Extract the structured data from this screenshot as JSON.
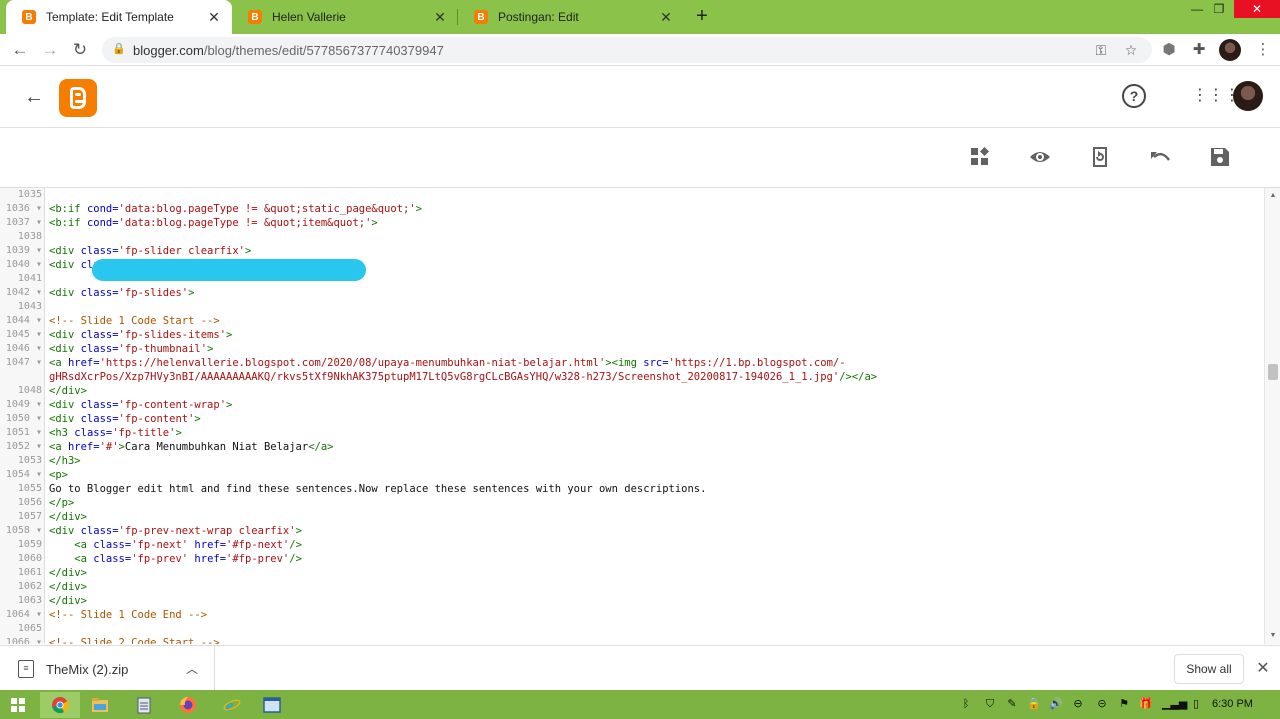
{
  "browser": {
    "tabs": [
      {
        "title": "Template: Edit Template",
        "favicon": "blogger-favicon-icon",
        "active": true
      },
      {
        "title": "Helen Vallerie",
        "favicon": "blogger-favicon-icon",
        "active": false
      },
      {
        "title": "Postingan: Edit",
        "favicon": "blogger-favicon-icon",
        "active": false
      }
    ],
    "url_domain": "blogger.com",
    "url_path": "/blog/themes/edit/5778567377740379947",
    "colors": {
      "frame": "#8bc34a",
      "accent": "#f57d00"
    }
  },
  "editor": {
    "lines": [
      {
        "n": "1035",
        "fold": false
      },
      {
        "n": "1036",
        "fold": true
      },
      {
        "n": "1037",
        "fold": true
      },
      {
        "n": "1038",
        "fold": false
      },
      {
        "n": "1039",
        "fold": true
      },
      {
        "n": "1040",
        "fold": true
      },
      {
        "n": "1041",
        "fold": false
      },
      {
        "n": "1042",
        "fold": true
      },
      {
        "n": "1043",
        "fold": false
      },
      {
        "n": "1044",
        "fold": true
      },
      {
        "n": "1045",
        "fold": true
      },
      {
        "n": "1046",
        "fold": true
      },
      {
        "n": "1047",
        "fold": true
      },
      {
        "n": "",
        "fold": false
      },
      {
        "n": "1048",
        "fold": false
      },
      {
        "n": "1049",
        "fold": true
      },
      {
        "n": "1050",
        "fold": true
      },
      {
        "n": "1051",
        "fold": true
      },
      {
        "n": "1052",
        "fold": true
      },
      {
        "n": "1053",
        "fold": false
      },
      {
        "n": "1054",
        "fold": true
      },
      {
        "n": "1055",
        "fold": false
      },
      {
        "n": "1056",
        "fold": false
      },
      {
        "n": "1057",
        "fold": false
      },
      {
        "n": "1058",
        "fold": true
      },
      {
        "n": "1059",
        "fold": false
      },
      {
        "n": "1060",
        "fold": false
      },
      {
        "n": "1061",
        "fold": false
      },
      {
        "n": "1062",
        "fold": false
      },
      {
        "n": "1063",
        "fold": false
      },
      {
        "n": "1064",
        "fold": true
      },
      {
        "n": "1065",
        "fold": false
      },
      {
        "n": "1066",
        "fold": true
      }
    ],
    "code": [
      [],
      [
        [
          "tag",
          "<b:if "
        ],
        [
          "attr",
          "cond="
        ],
        [
          "str",
          "'data:blog.pageType != &quot;static_page&quot;'"
        ],
        [
          "tag",
          ">"
        ]
      ],
      [
        [
          "tag",
          "<b:if "
        ],
        [
          "attr",
          "cond="
        ],
        [
          "str",
          "'data:blog.pageType != &quot;item&quot;'"
        ],
        [
          "tag",
          ">"
        ]
      ],
      [],
      [
        [
          "tag",
          "<div "
        ],
        [
          "attr",
          "class="
        ],
        [
          "str",
          "'fp-slider clearfix'"
        ],
        [
          "tag",
          ">"
        ]
      ],
      [
        [
          "tag",
          "<div "
        ],
        [
          "attr",
          "class="
        ],
        [
          "str",
          "'fp-slides-container clearfix'"
        ],
        [
          "tag",
          ">"
        ]
      ],
      [],
      [
        [
          "tag",
          "<div "
        ],
        [
          "attr",
          "class="
        ],
        [
          "str",
          "'fp-slides'"
        ],
        [
          "tag",
          ">"
        ]
      ],
      [],
      [
        [
          "cmt",
          "<!-- Slide 1 Code Start -->"
        ]
      ],
      [
        [
          "tag",
          "<div "
        ],
        [
          "attr",
          "class="
        ],
        [
          "str",
          "'fp-slides-items'"
        ],
        [
          "tag",
          ">"
        ]
      ],
      [
        [
          "tag",
          "<div "
        ],
        [
          "attr",
          "class="
        ],
        [
          "str",
          "'fp-thumbnail'"
        ],
        [
          "tag",
          ">"
        ]
      ],
      [
        [
          "tag",
          "<a "
        ],
        [
          "attr",
          "href="
        ],
        [
          "str",
          "'https://helenvallerie.blogspot.com/2020/08/upaya-menumbuhkan-niat-belajar.html'"
        ],
        [
          "tag",
          "><img "
        ],
        [
          "attr",
          "src="
        ],
        [
          "str",
          "'https://1.bp.blogspot.com/-"
        ]
      ],
      [
        [
          "str",
          "gHRsdXcrPos/Xzp7HVy3nBI/AAAAAAAAAKQ/rkvs5tXf9NkhAK375ptupM17LtQ5vG8rgCLcBGAsYHQ/w328-h273/Screenshot_20200817-194026_1_1.jpg'"
        ],
        [
          "tag",
          "/></a>"
        ]
      ],
      [
        [
          "tag",
          "</div>"
        ]
      ],
      [
        [
          "tag",
          "<div "
        ],
        [
          "attr",
          "class="
        ],
        [
          "str",
          "'fp-content-wrap'"
        ],
        [
          "tag",
          ">"
        ]
      ],
      [
        [
          "tag",
          "<div "
        ],
        [
          "attr",
          "class="
        ],
        [
          "str",
          "'fp-content'"
        ],
        [
          "tag",
          ">"
        ]
      ],
      [
        [
          "tag",
          "<h3 "
        ],
        [
          "attr",
          "class="
        ],
        [
          "str",
          "'fp-title'"
        ],
        [
          "tag",
          ">"
        ]
      ],
      [
        [
          "tag",
          "<a "
        ],
        [
          "attr",
          "href="
        ],
        [
          "str",
          "'#'"
        ],
        [
          "tag",
          ">"
        ],
        [
          "plain",
          "Cara Menumbuhkan Niat Belajar"
        ],
        [
          "tag",
          "</a>"
        ]
      ],
      [
        [
          "tag",
          "</h3>"
        ]
      ],
      [
        [
          "tag",
          "<p>"
        ]
      ],
      [
        [
          "plain",
          "Go to Blogger edit html and find these sentences.Now replace these sentences with your own descriptions."
        ]
      ],
      [
        [
          "tag",
          "</p>"
        ]
      ],
      [
        [
          "tag",
          "</div>"
        ]
      ],
      [
        [
          "tag",
          "<div "
        ],
        [
          "attr",
          "class="
        ],
        [
          "str",
          "'fp-prev-next-wrap clearfix'"
        ],
        [
          "tag",
          ">"
        ]
      ],
      [
        [
          "plain",
          "    "
        ],
        [
          "tag",
          "<a "
        ],
        [
          "attr",
          "class="
        ],
        [
          "str",
          "'fp-next' "
        ],
        [
          "attr",
          "href="
        ],
        [
          "str",
          "'#fp-next'"
        ],
        [
          "tag",
          "/>"
        ]
      ],
      [
        [
          "plain",
          "    "
        ],
        [
          "tag",
          "<a "
        ],
        [
          "attr",
          "class="
        ],
        [
          "str",
          "'fp-prev' "
        ],
        [
          "attr",
          "href="
        ],
        [
          "str",
          "'#fp-prev'"
        ],
        [
          "tag",
          "/>"
        ]
      ],
      [
        [
          "tag",
          "</div>"
        ]
      ],
      [
        [
          "tag",
          "</div>"
        ]
      ],
      [
        [
          "tag",
          "</div>"
        ]
      ],
      [
        [
          "cmt",
          "<!-- Slide 1 Code End -->"
        ]
      ],
      [],
      [
        [
          "cmt",
          "<!-- Slide 2 Code Start -->"
        ]
      ]
    ]
  },
  "download": {
    "filename": "TheMix (2).zip",
    "show_all": "Show all"
  },
  "taskbar": {
    "clock": "6:30 PM",
    "apps": [
      "windows-start-icon",
      "chrome-icon",
      "file-explorer-icon",
      "notepad-icon",
      "firefox-icon",
      "ie-icon",
      "window-icon"
    ]
  }
}
